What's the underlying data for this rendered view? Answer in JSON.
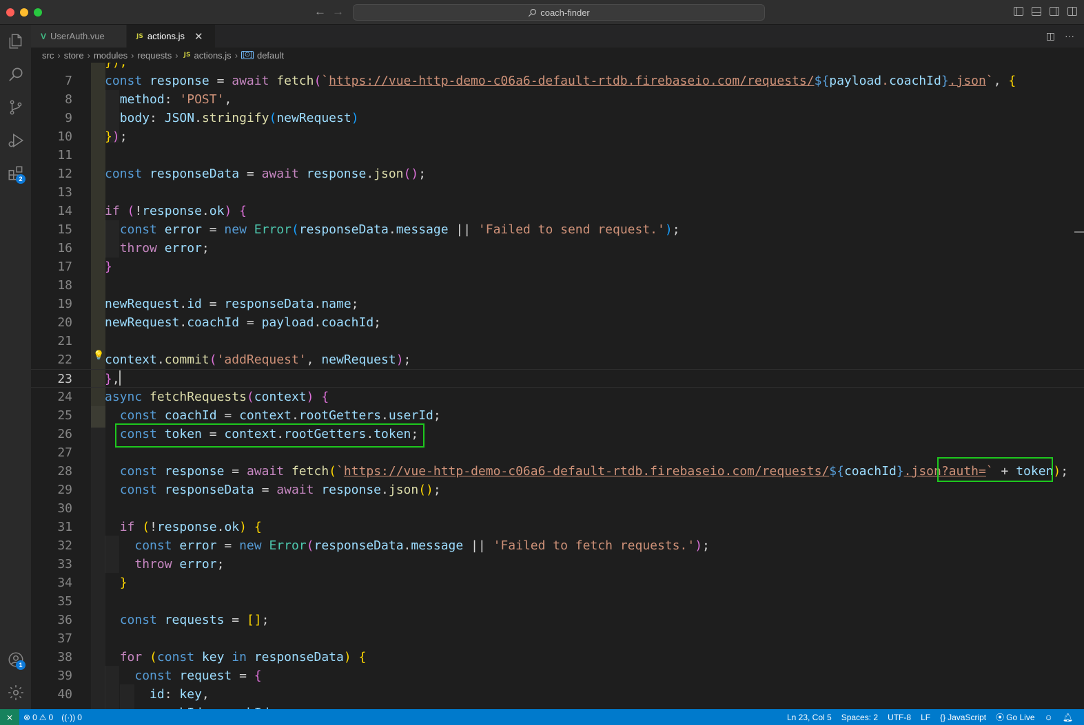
{
  "window": {
    "title": "coach-finder"
  },
  "tabs": [
    {
      "label": "UserAuth.vue",
      "icon": "vue-icon",
      "active": false
    },
    {
      "label": "actions.js",
      "icon": "js-icon",
      "active": true
    }
  ],
  "breadcrumb": {
    "items": [
      "src",
      "store",
      "modules",
      "requests",
      "actions.js",
      "default"
    ],
    "js_badge": "JS"
  },
  "activity_bar": {
    "extensions_badge": "2",
    "accounts_badge": "1"
  },
  "editor": {
    "current_line": 23,
    "line_numbers": [
      "7",
      "8",
      "9",
      "10",
      "11",
      "12",
      "13",
      "14",
      "15",
      "16",
      "17",
      "18",
      "19",
      "20",
      "21",
      "22",
      "23",
      "24",
      "25",
      "26",
      "27",
      "28",
      "29",
      "30",
      "31",
      "32",
      "33",
      "34",
      "35",
      "36",
      "37",
      "38",
      "39",
      "40"
    ]
  },
  "status_bar": {
    "errors": "0",
    "warnings": "0",
    "ports": "0",
    "position": "Ln 23, Col 5",
    "spaces": "Spaces: 2",
    "encoding": "UTF-8",
    "eol": "LF",
    "language": "JavaScript",
    "live": "Go Live"
  },
  "colors": {
    "accent": "#007acc",
    "highlight_box": "#1ec81e",
    "keyword": "#569cd6",
    "string": "#ce9178",
    "function": "#dcdcaa"
  }
}
